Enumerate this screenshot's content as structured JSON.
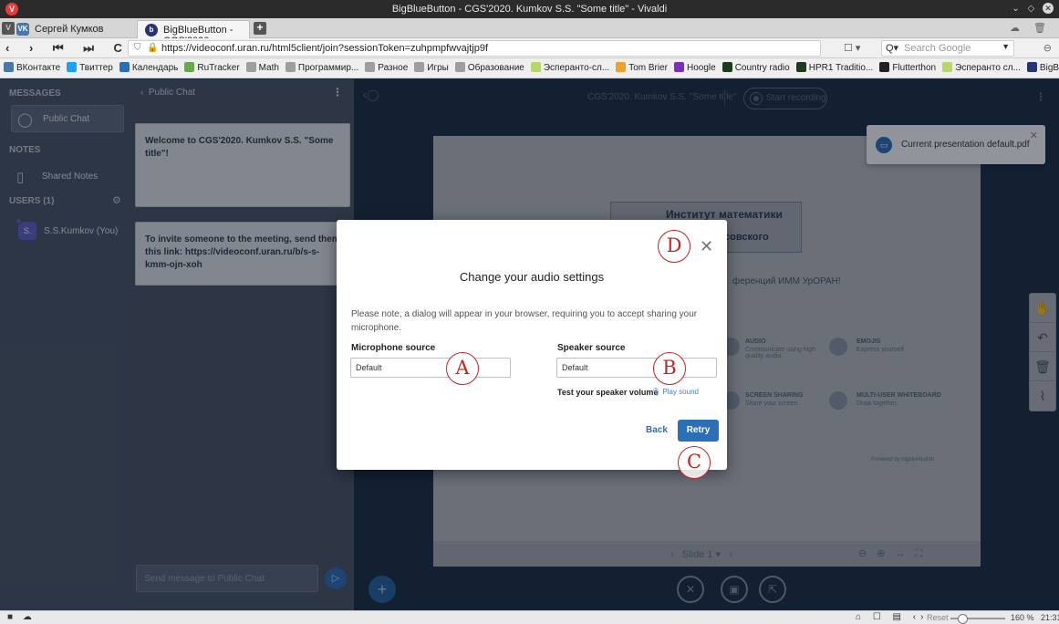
{
  "window": {
    "title": "BigBlueButton - CGS'2020. Kumkov S.S. \"Some title\" - Vivaldi"
  },
  "tabs": [
    {
      "label": "Сергей Кумков"
    },
    {
      "label": "BigBlueButton - CGS'2020."
    }
  ],
  "address": {
    "url": "https://videoconf.uran.ru/html5client/join?sessionToken=zuhpmpfwvajtjp9f",
    "search_placeholder": "Search Google"
  },
  "bookmarks": [
    {
      "label": "ВКонтакте",
      "color": "#4a76a8"
    },
    {
      "label": "Твиттер",
      "color": "#1da1f2"
    },
    {
      "label": "Календарь",
      "color": "#2b6fb8"
    },
    {
      "label": "RuTracker",
      "color": "#6aa84f"
    },
    {
      "label": "Math",
      "color": "#9e9e9e"
    },
    {
      "label": "Программир...",
      "color": "#9e9e9e"
    },
    {
      "label": "Разное",
      "color": "#9e9e9e"
    },
    {
      "label": "Игры",
      "color": "#9e9e9e"
    },
    {
      "label": "Образование",
      "color": "#9e9e9e"
    },
    {
      "label": "Эсперанто-сл...",
      "color": "#b7d66b"
    },
    {
      "label": "Tom Brier",
      "color": "#f0a030"
    },
    {
      "label": "Hoogle",
      "color": "#7b2fbe"
    },
    {
      "label": "Country radio",
      "color": "#1f3a1f"
    },
    {
      "label": "HPR1 Traditio...",
      "color": "#1f3a1f"
    },
    {
      "label": "Flutterthon",
      "color": "#222222"
    },
    {
      "label": "Эсперанто сл...",
      "color": "#b7d66b"
    },
    {
      "label": "BigBlueButton",
      "color": "#283274"
    }
  ],
  "userlist": {
    "messages_heading": "MESSAGES",
    "public_chat": "Public Chat",
    "notes_heading": "NOTES",
    "shared_notes": "Shared Notes",
    "users_heading": "USERS (1)",
    "user_name": "S.S.Kumkov (You)",
    "user_initials": "S."
  },
  "chat": {
    "header": "Public Chat",
    "welcome": "Welcome to CGS'2020. Kumkov S.S. \"Some title\"!",
    "invite": "To invite someone to the meeting, send them this link: https://videoconf.uran.ru/b/s-s-kmm-ojn-xoh",
    "input_placeholder": "Send message to Public Chat"
  },
  "main": {
    "meeting_title": "CGS'2020. Kumkov S.S. \"Some title\"",
    "record_label": "Start recording",
    "slide_label": "Slide 1",
    "toast_text": "Current presentation default.pdf",
    "slide": {
      "logo_line1": "Институт математики",
      "logo_line2": "совского",
      "subtitle": "ференций ИММ УрОРАН!",
      "f_audio_t": "AUDIO",
      "f_audio_d": "Communicate using high quality audio.",
      "f_emoji_t": "EMOJIS",
      "f_emoji_d": "Express yourself.",
      "f_share_t": "SCREEN SHARING",
      "f_share_d": "Share your screen.",
      "f_wb_t": "MULTI-USER WHITEBOARD",
      "f_wb_d": "Draw together.",
      "powered": "Powered by bigbluebutton"
    }
  },
  "modal": {
    "title": "Change your audio settings",
    "note": "Please note, a dialog will appear in your browser, requiring you to accept sharing your microphone.",
    "mic_label": "Microphone source",
    "mic_value": "Default",
    "speaker_label": "Speaker source",
    "speaker_value": "Default",
    "test_volume": "Test your speaker volume",
    "play_sound": "Play sound",
    "back": "Back",
    "retry": "Retry"
  },
  "markers": {
    "a": "A",
    "b": "B",
    "c": "C",
    "d": "D"
  },
  "statusbar": {
    "reset": "Reset",
    "zoom": "160 %",
    "clock": "21:31"
  }
}
